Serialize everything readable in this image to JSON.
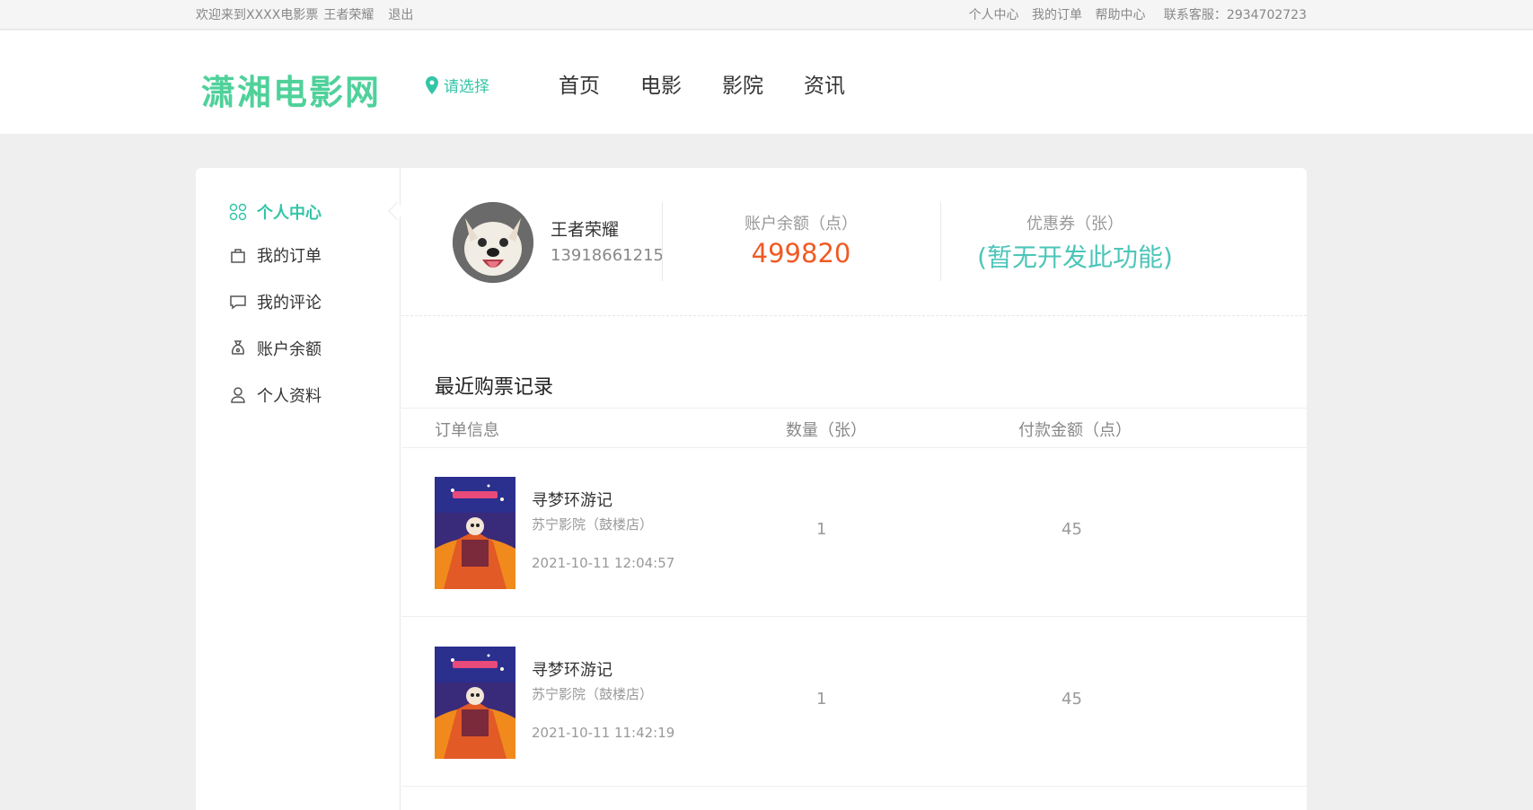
{
  "topbar": {
    "welcome": "欢迎来到XXXX电影票",
    "username": "王者荣耀",
    "logout": "退出",
    "links": [
      "个人中心",
      "我的订单",
      "帮助中心"
    ],
    "contact": "联系客服：2934702723"
  },
  "header": {
    "logo": "潇湘电影网",
    "city": "请选择",
    "nav": [
      "首页",
      "电影",
      "影院",
      "资讯"
    ]
  },
  "sidebar": {
    "items": [
      {
        "label": "个人中心",
        "icon": "grid-icon",
        "active": true
      },
      {
        "label": "我的订单",
        "icon": "bag-icon",
        "active": false
      },
      {
        "label": "我的评论",
        "icon": "comment-icon",
        "active": false
      },
      {
        "label": "账户余额",
        "icon": "money-bag-icon",
        "active": false
      },
      {
        "label": "个人资料",
        "icon": "user-icon",
        "active": false
      }
    ]
  },
  "profile": {
    "name": "王者荣耀",
    "phone": "13918661215",
    "balance_label": "账户余额（点）",
    "balance": "499820",
    "coupon_label": "优惠券（张）",
    "coupon": "(暂无开发此功能)"
  },
  "records": {
    "title": "最近购票记录",
    "columns": [
      "订单信息",
      "数量（张）",
      "付款金额（点）"
    ],
    "rows": [
      {
        "movie": "寻梦环游记",
        "cinema": "苏宁影院（鼓楼店）",
        "time": "2021-10-11 12:04:57",
        "qty": "1",
        "amount": "45"
      },
      {
        "movie": "寻梦环游记",
        "cinema": "苏宁影院（鼓楼店）",
        "time": "2021-10-11 11:42:19",
        "qty": "1",
        "amount": "45"
      }
    ]
  },
  "colors": {
    "accent": "#33c5a7",
    "logo": "#4fd19a",
    "balance": "#f05a24",
    "coupon": "#4cc6b9"
  }
}
